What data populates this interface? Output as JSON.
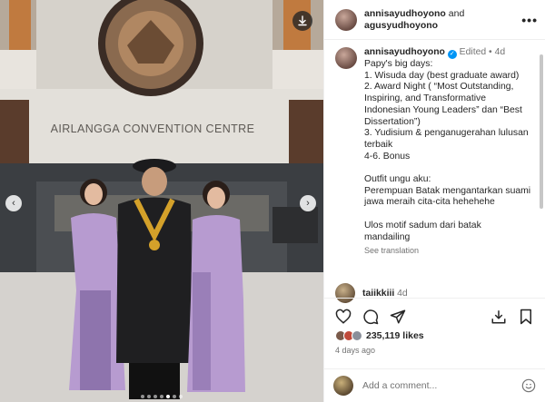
{
  "photo": {
    "building_sign": "AIRLANGGA CONVENTION CENTRE",
    "carousel_dots": 7,
    "active_dot": 4
  },
  "header": {
    "user1": "annisayudhoyono",
    "and": " and",
    "user2": "agusyudhoyono",
    "more": "•••"
  },
  "caption": {
    "username": "annisayudhoyono",
    "edited": " Edited • ",
    "age": "4d",
    "lines": [
      "Papy's big days:",
      "1. Wisuda day (best graduate award)",
      "2. Award Night ( “Most Outstanding,",
      "Inspiring, and Transformative",
      "Indonesian Young Leaders” dan “Best",
      "Dissertation”)",
      "3. Yudisium & penganugerahan lulusan",
      "terbaik",
      "4-6. Bonus",
      "",
      "Outfit ungu aku:",
      "Perempuan Batak mengantarkan suami",
      "jawa meraih cita-cita hehehehe",
      "",
      "Ulos motif sadum dari batak",
      "mandailing"
    ],
    "see_translation": "See translation"
  },
  "comment": {
    "username": "taiikkiii",
    "age": "4d"
  },
  "likes": {
    "count": "235,119 likes"
  },
  "posted": "4 days ago",
  "add_comment": {
    "placeholder": "Add a comment..."
  },
  "colors": {
    "verified": "#0095f6",
    "muted": "#737373",
    "text": "#262626"
  }
}
